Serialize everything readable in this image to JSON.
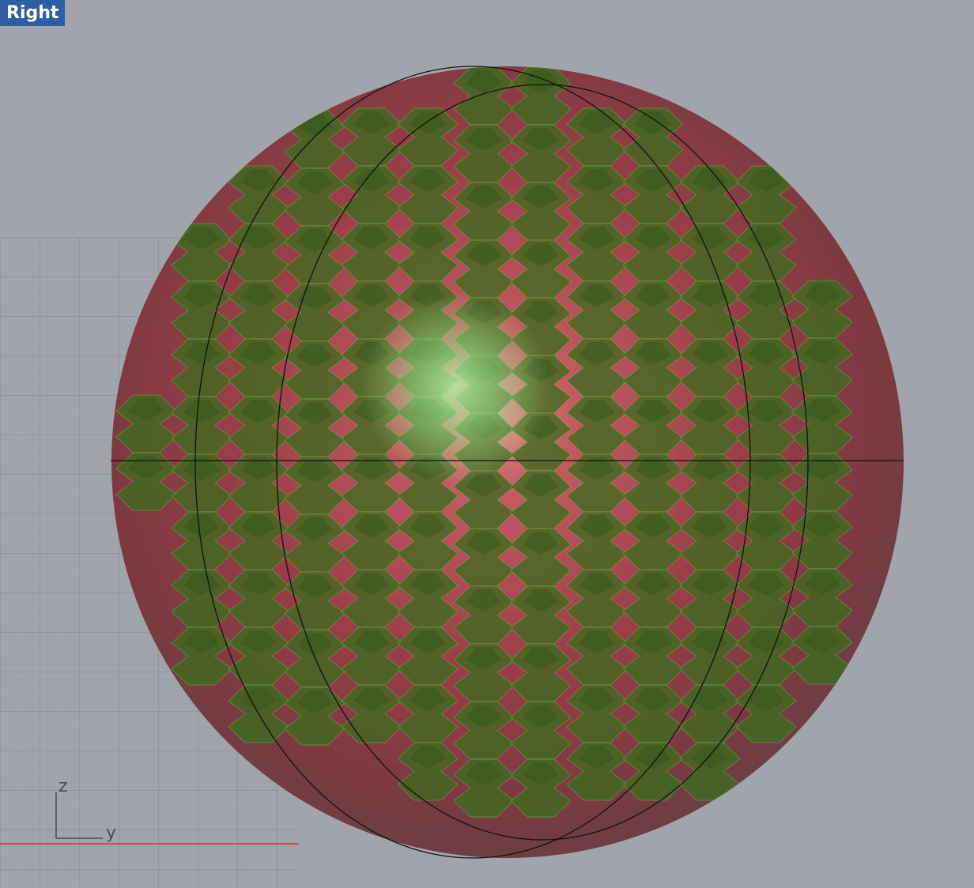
{
  "viewport": {
    "title": "Right",
    "background_color": "#a1a5ab",
    "grid_color": "#8d9297",
    "y_axis_line_color": "#c0524f"
  },
  "axis_widget": {
    "vertical_label": "z",
    "horizontal_label": "y"
  },
  "scene": {
    "sphere_fill_color": "#8a3a42",
    "sphere_highlight_color": "#e48a8c",
    "panel_fill_color": "#3d6b1f",
    "panel_edge_color": "#7fd45f",
    "wire_color": "#111111",
    "light_spot_color": "#9be08a"
  }
}
